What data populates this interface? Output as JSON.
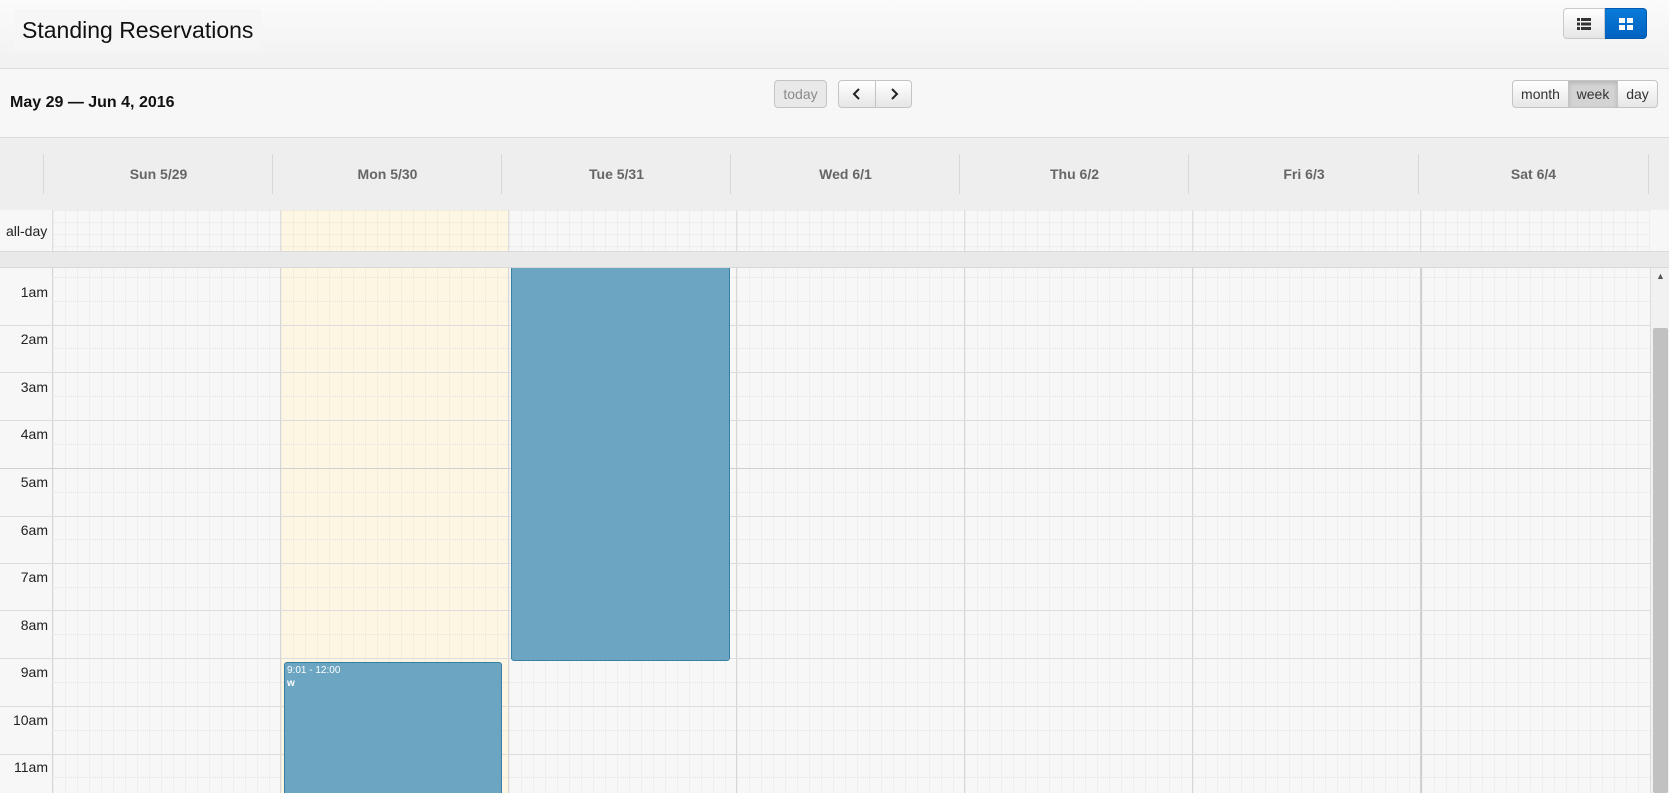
{
  "header": {
    "title": "Standing Reservations",
    "list_view_icon": "list-icon",
    "calendar_view_icon": "calendar-grid-icon"
  },
  "toolbar": {
    "range_title": "May 29 — Jun 4, 2016",
    "today_label": "today",
    "prev_icon": "chevron-left-icon",
    "next_icon": "chevron-right-icon",
    "views": [
      "month",
      "week",
      "day"
    ],
    "active_view": "week"
  },
  "calendar": {
    "days": [
      "Sun 5/29",
      "Mon 5/30",
      "Tue 5/31",
      "Wed 6/1",
      "Thu 6/2",
      "Fri 6/3",
      "Sat 6/4"
    ],
    "today_index": 1,
    "allday_label": "all-day",
    "hours": [
      "1am",
      "2am",
      "3am",
      "4am",
      "5am",
      "6am",
      "7am",
      "8am",
      "9am",
      "10am",
      "11am"
    ],
    "events": [
      {
        "day": "Mon 5/30",
        "time": "9:01 - 12:00",
        "title": "w"
      },
      {
        "day": "Tue 5/31",
        "time": "",
        "title": ""
      }
    ]
  },
  "colors": {
    "event": "#6ba5c2",
    "today_highlight": "#fcf6e3",
    "accent": "#0a7ad8"
  }
}
